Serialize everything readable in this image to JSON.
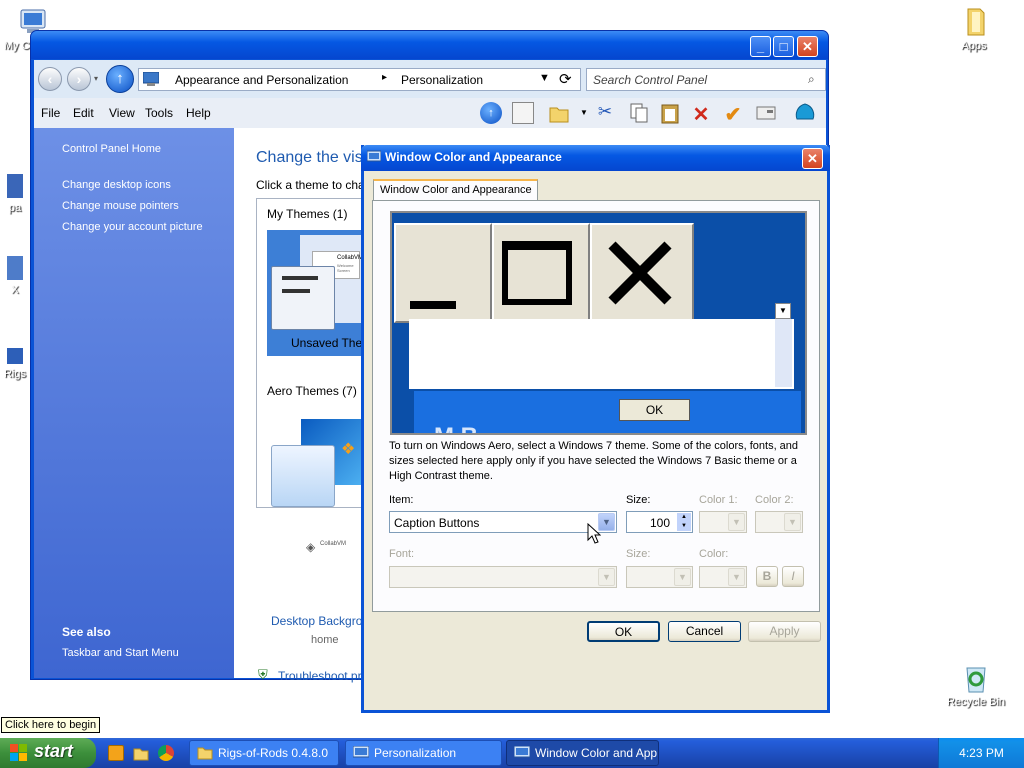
{
  "desktop": {
    "icons": [
      {
        "label": "My C",
        "name": "my-computer-icon"
      },
      {
        "label": "Apps",
        "name": "apps-folder-icon"
      },
      {
        "label": "Recycle Bin",
        "name": "recycle-bin-icon"
      },
      {
        "label": "pa",
        "name": "desktop-shortcut-icon"
      },
      {
        "label": "X",
        "name": "desktop-shortcut-icon"
      },
      {
        "label": "Rigs",
        "name": "rigs-of-rods-icon"
      }
    ],
    "tooltip": "Click here to begin"
  },
  "explorer": {
    "breadcrumb": [
      "Appearance and Personalization",
      "Personalization"
    ],
    "search_placeholder": "Search Control Panel",
    "menu": [
      "File",
      "Edit",
      "View",
      "Tools",
      "Help"
    ],
    "sidebar": {
      "home": "Control Panel Home",
      "links": [
        "Change desktop icons",
        "Change mouse pointers",
        "Change your account picture"
      ],
      "see_also_title": "See also",
      "see_also_links": [
        "Taskbar and Start Menu"
      ]
    },
    "main": {
      "heading": "Change the visu",
      "subheading": "Click a theme to cha",
      "my_themes": "My Themes (1)",
      "unsaved_theme": "Unsaved The",
      "aero_themes": "Aero Themes (7)",
      "desktop_background": "Desktop Backgro",
      "desktop_background_sub": "home",
      "troubleshoot": "Troubleshoot pr",
      "thumb_brand": "CollabVM",
      "thumb_caption": "Welcome Screen"
    }
  },
  "dialog": {
    "title": "Window Color and Appearance",
    "tab": "Window Color and Appearance",
    "preview": {
      "ok": "OK",
      "caption_glyphs": [
        "_",
        "□",
        "✕"
      ],
      "message_letters": "M    B"
    },
    "info": "To turn on Windows Aero, select a Windows 7 theme.  Some of the colors, fonts, and sizes selected here apply only if you have selected the Windows 7 Basic theme or a High Contrast theme.",
    "item_label": "Item:",
    "item_value": "Caption Buttons",
    "size_label": "Size:",
    "size_value": "100",
    "color1_label": "Color 1:",
    "color2_label": "Color 2:",
    "font_label": "Font:",
    "font_size_label": "Size:",
    "font_color_label": "Color:",
    "bold": "B",
    "italic": "I",
    "buttons": {
      "ok": "OK",
      "cancel": "Cancel",
      "apply": "Apply"
    }
  },
  "taskbar": {
    "start": "start",
    "items": [
      {
        "label": "Rigs-of-Rods 0.4.8.0",
        "active": false
      },
      {
        "label": "Personalization",
        "active": false
      },
      {
        "label": "Window Color and App...",
        "active": true
      }
    ],
    "clock": "4:23 PM"
  },
  "colors": {
    "xp_blue": "#0a53d6",
    "dialog_face": "#ece9d8",
    "start_green": "#3c8f3b",
    "preview_blue": "#0b4fa8"
  }
}
